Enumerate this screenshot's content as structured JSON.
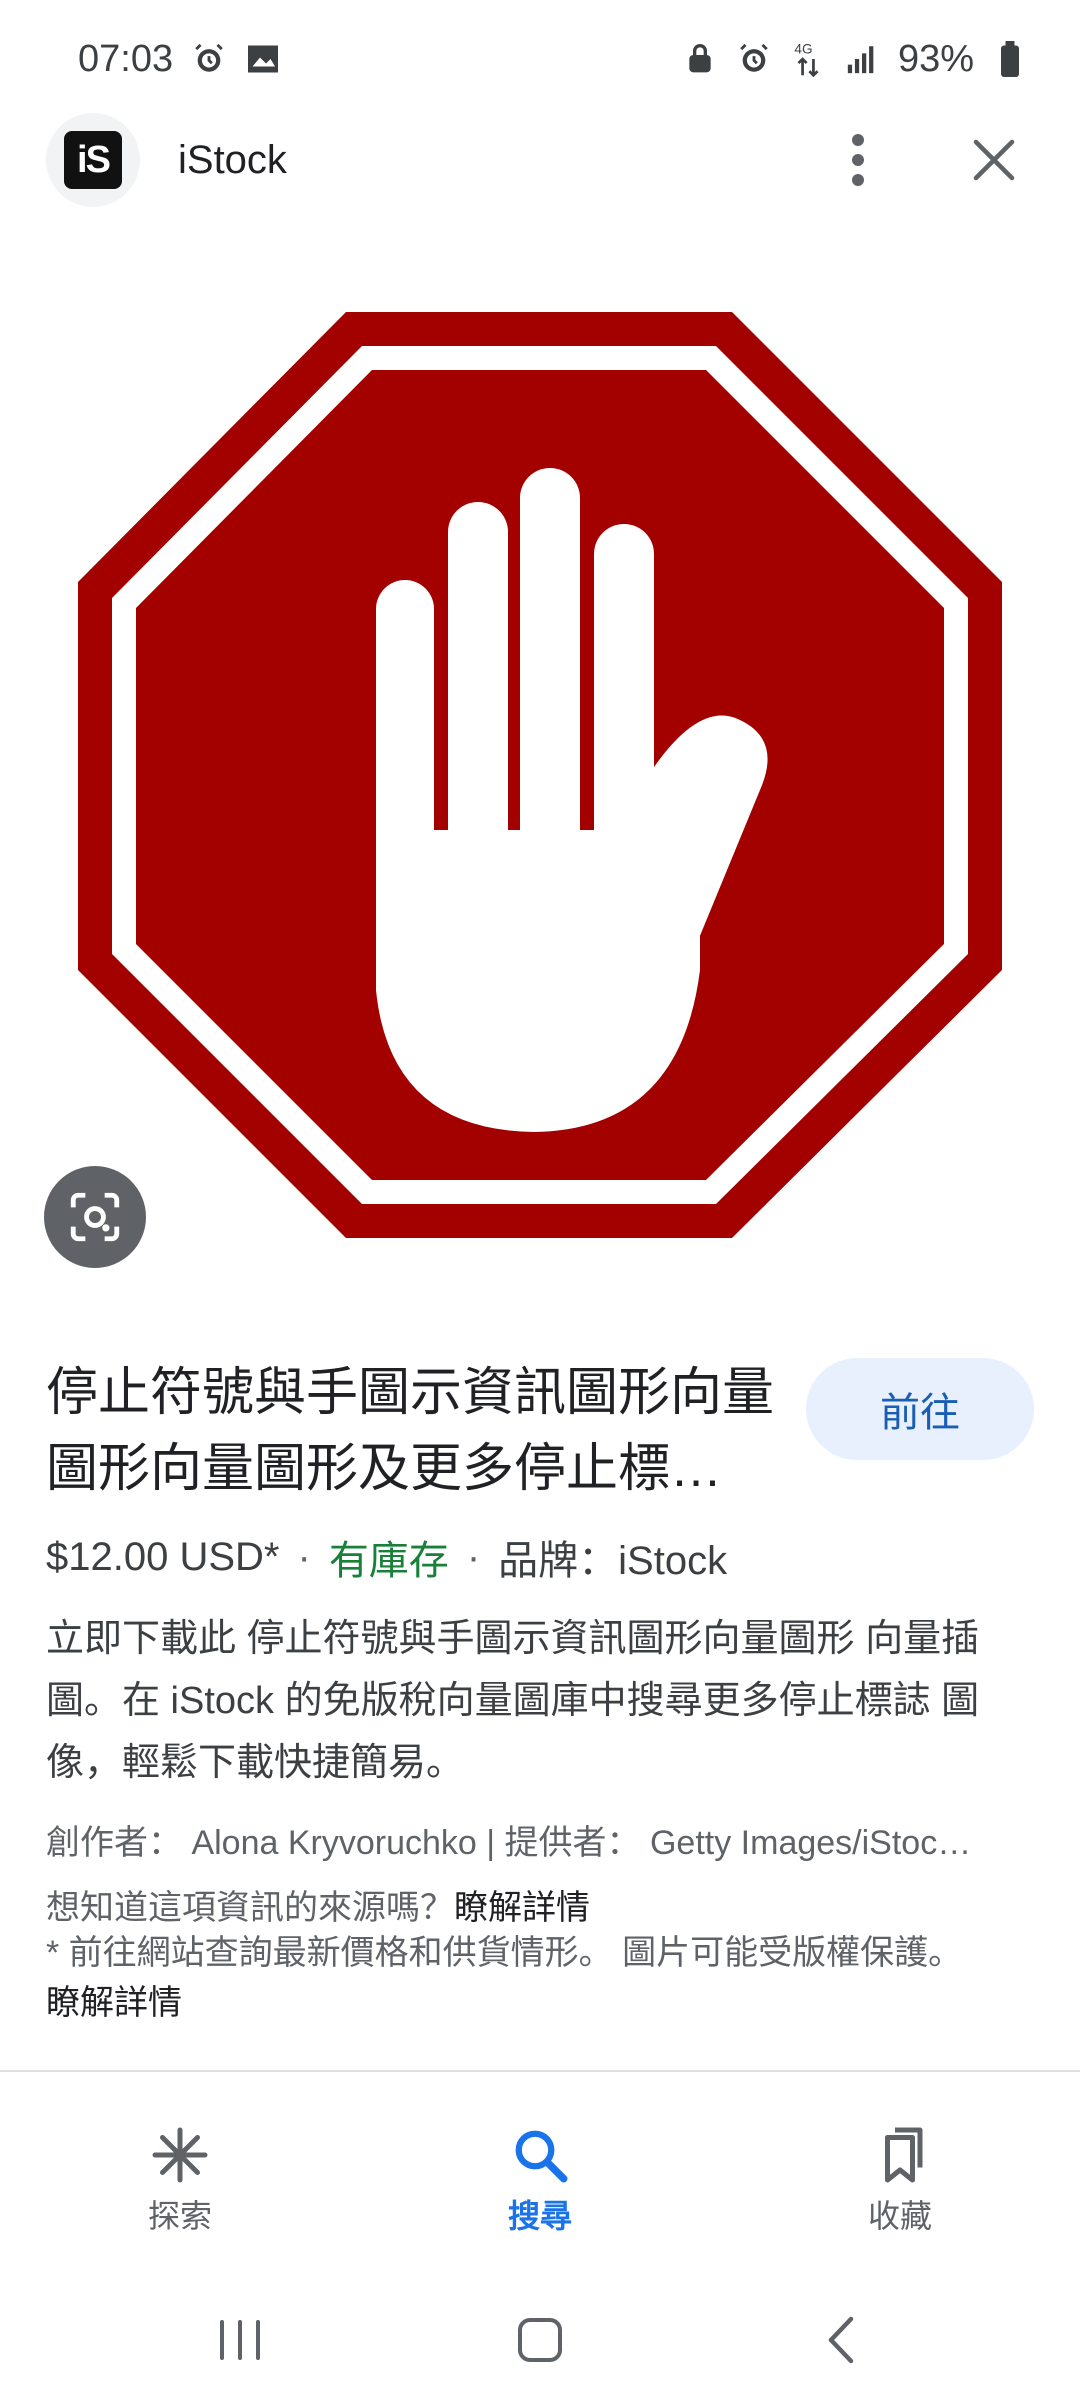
{
  "status_bar": {
    "time": "07:03",
    "battery": "93%",
    "network": "4G",
    "icons_left": [
      "alarm-icon",
      "gallery-icon"
    ],
    "icons_right": [
      "vpn-icon",
      "alarm-icon",
      "network-4g-icon",
      "signal-icon",
      "battery-icon"
    ]
  },
  "header": {
    "logo_text": "iS",
    "site_name": "iStock",
    "more_icon": "more-vert-icon",
    "close_icon": "close-icon"
  },
  "image": {
    "subject": "stop-sign-hand",
    "colors": {
      "octagon": "#a30000",
      "border": "#ffffff",
      "hand": "#ffffff"
    }
  },
  "lens_icon": "lens-icon",
  "result": {
    "title": "停止符號與手圖示資訊圖形向量圖形向量圖形及更多停止標…",
    "visit_button": "前往",
    "price": "$12.00 USD*",
    "stock": "有庫存",
    "brand": "品牌：iStock",
    "description": "立即下載此 停止符號與手圖示資訊圖形向量圖形 向量插圖。在 iStock 的免版稅向量圖庫中搜尋更多停止標誌 圖像，輕鬆下載快捷簡易。",
    "credit": "創作者： Alona Kryvoruchko | 提供者： Getty Images/iStoc…",
    "source_question": "想知道這項資訊的來源嗎？",
    "learn_more": "瞭解詳情",
    "disclaimer": "* 前往網站查詢最新價格和供貨情形。 圖片可能受版權保護。",
    "disclaimer_link": "瞭解詳情"
  },
  "bottom_nav": {
    "items": [
      {
        "label": "探索",
        "icon": "discover-icon",
        "active": false
      },
      {
        "label": "搜尋",
        "icon": "search-icon",
        "active": true
      },
      {
        "label": "收藏",
        "icon": "collections-icon",
        "active": false
      }
    ]
  },
  "system_nav": {
    "recent": "recent-apps-icon",
    "home": "home-icon",
    "back": "back-icon"
  },
  "colors": {
    "accent": "#1a73e8",
    "button_bg": "#e8f0fe",
    "stock_green": "#188038"
  }
}
